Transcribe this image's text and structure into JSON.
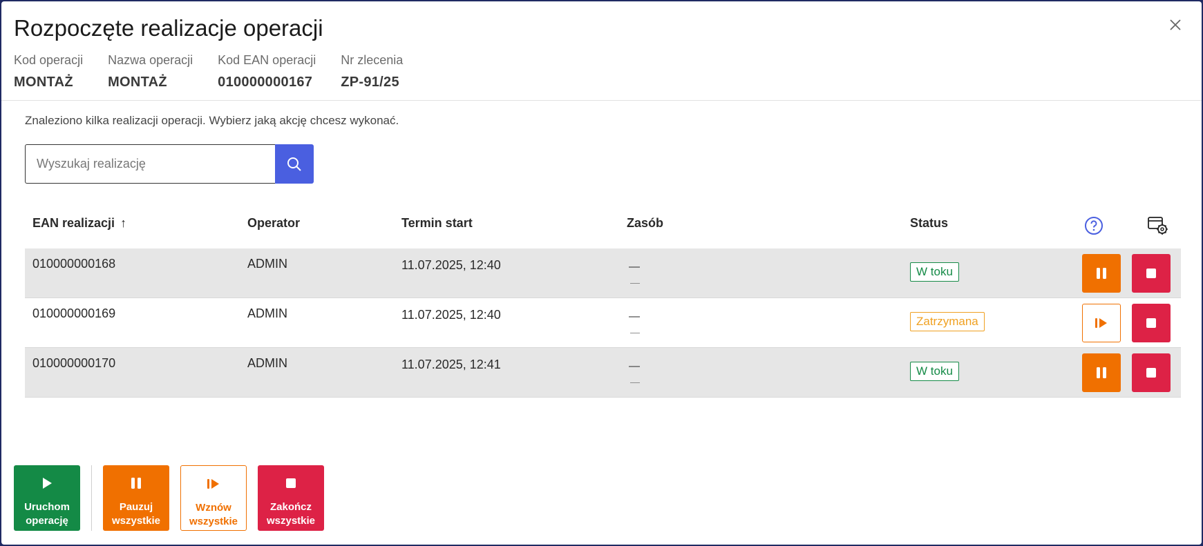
{
  "dialog": {
    "title": "Rozpoczęte realizacje operacji",
    "meta": [
      {
        "label": "Kod operacji",
        "value": "MONTAŻ"
      },
      {
        "label": "Nazwa operacji",
        "value": "MONTAŻ"
      },
      {
        "label": "Kod EAN operacji",
        "value": "010000000167"
      },
      {
        "label": "Nr zlecenia",
        "value": "ZP-91/25"
      }
    ],
    "info": "Znaleziono kilka realizacji operacji. Wybierz jaką akcję chcesz wykonać."
  },
  "search": {
    "placeholder": "Wyszukaj realizację"
  },
  "table": {
    "headers": {
      "ean": "EAN realizacji",
      "operator": "Operator",
      "termin": "Termin start",
      "zasob": "Zasób",
      "status": "Status"
    },
    "sort_indicator": "↑",
    "rows": [
      {
        "ean": "010000000168",
        "operator": "ADMIN",
        "termin": "11.07.2025, 12:40",
        "zasob_line1": "—",
        "zasob_line2": "—",
        "status": "W toku",
        "status_color": "#148a46"
      },
      {
        "ean": "010000000169",
        "operator": "ADMIN",
        "termin": "11.07.2025, 12:40",
        "zasob_line1": "—",
        "zasob_line2": "—",
        "status": "Zatrzymana",
        "status_color": "#f0a020"
      },
      {
        "ean": "010000000170",
        "operator": "ADMIN",
        "termin": "11.07.2025, 12:41",
        "zasob_line1": "—",
        "zasob_line2": "—",
        "status": "W toku",
        "status_color": "#148a46"
      }
    ]
  },
  "footer": {
    "start_line1": "Uruchom",
    "start_line2": "operację",
    "pause_line1": "Pauzuj",
    "pause_line2": "wszystkie",
    "resume_line1": "Wznów",
    "resume_line2": "wszystkie",
    "end_line1": "Zakończ",
    "end_line2": "wszystkie"
  },
  "colors": {
    "accent_blue": "#4a5fe0",
    "green": "#148a46",
    "orange": "#f07000",
    "red": "#dd2246",
    "status_orange": "#f0a020"
  },
  "icons": {
    "close": "close-icon",
    "search": "search-icon",
    "help": "help-icon",
    "column_settings": "column-settings-icon",
    "pause": "pause-icon",
    "stop": "stop-icon",
    "resume": "resume-icon",
    "play": "play-icon"
  }
}
